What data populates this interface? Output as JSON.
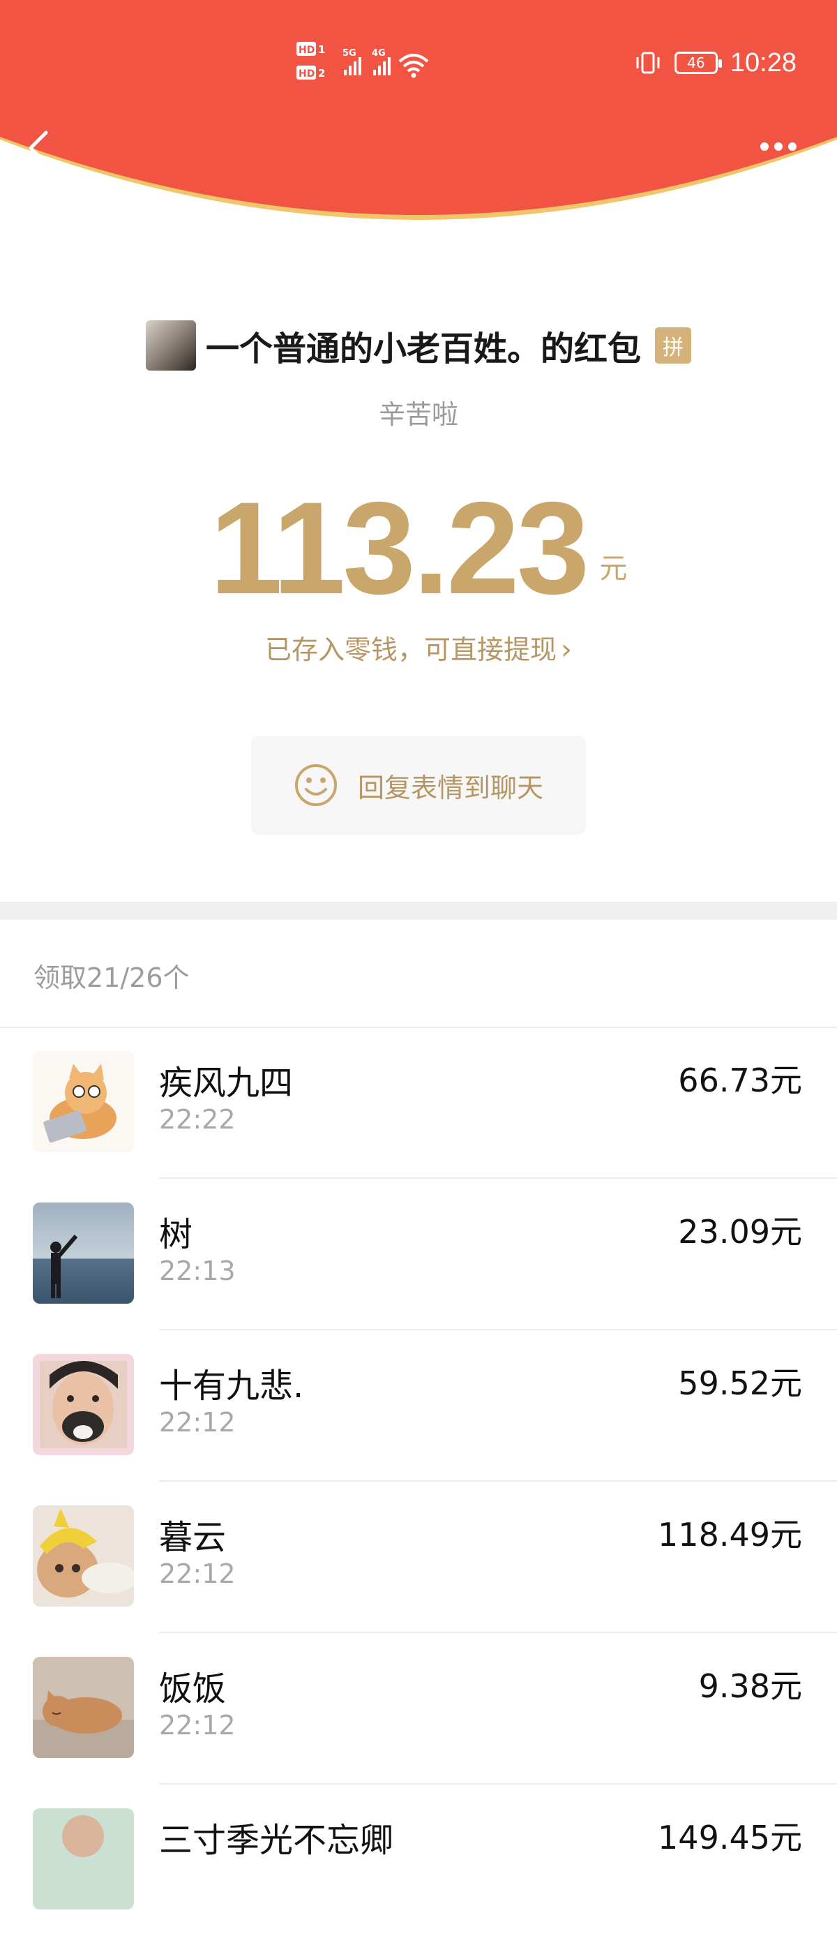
{
  "status_bar": {
    "network_left": [
      "HD 1",
      "HD 2"
    ],
    "signal1": "5G",
    "signal2": "4G",
    "battery": "46",
    "time": "10:28"
  },
  "header": {
    "back_icon": "back-arrow-icon",
    "more_icon": "more-dots-icon",
    "brand_color": "#f25443",
    "curve_accent": "#f1c56a"
  },
  "packet": {
    "title": "一个普通的小老百姓。的红包",
    "badge": "拼",
    "blessing": "辛苦啦",
    "amount": "113.23",
    "unit": "元",
    "stored_text": "已存入零钱，可直接提现",
    "stored_chevron": "›",
    "accent_color": "#c9a66b"
  },
  "reply": {
    "icon": "smiley-icon",
    "label": "回复表情到聊天"
  },
  "receivers": {
    "count_label": "领取21/26个",
    "items": [
      {
        "name": "疾风九四",
        "time": "22:22",
        "amount": "66.73元"
      },
      {
        "name": "树",
        "time": "22:13",
        "amount": "23.09元"
      },
      {
        "name": "十有九悲.",
        "time": "22:12",
        "amount": "59.52元"
      },
      {
        "name": "暮云",
        "time": "22:12",
        "amount": "118.49元"
      },
      {
        "name": "饭饭",
        "time": "22:12",
        "amount": "9.38元"
      },
      {
        "name": "三寸季光不忘卿",
        "time": "",
        "amount": "149.45元"
      }
    ]
  }
}
